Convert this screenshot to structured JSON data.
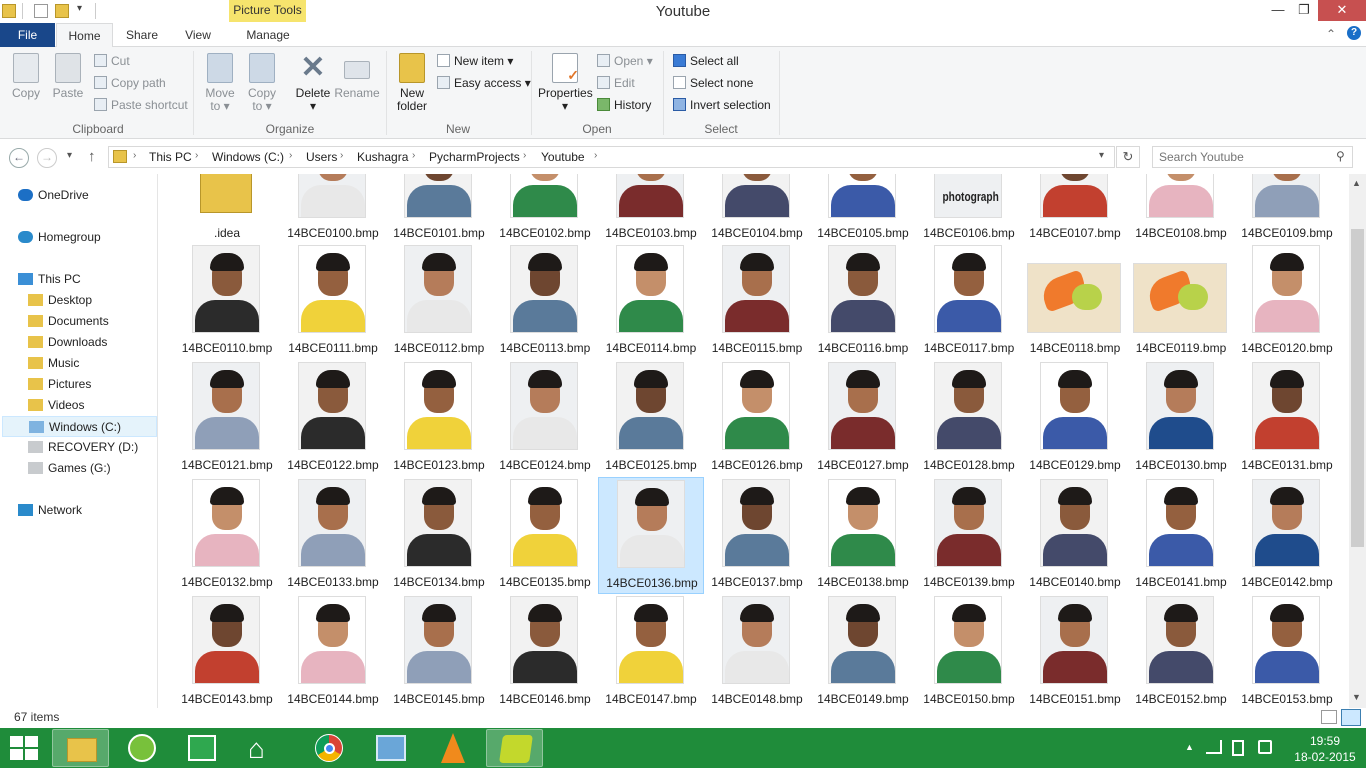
{
  "window": {
    "title": "Youtube",
    "picture_tools_label": "Picture Tools",
    "min_glyph": "—",
    "max_glyph": "❐",
    "close_glyph": "✕"
  },
  "tabs": {
    "file": "File",
    "home": "Home",
    "share": "Share",
    "view": "View",
    "manage": "Manage"
  },
  "ribbon": {
    "clipboard": {
      "label": "Clipboard",
      "copy": "Copy",
      "paste": "Paste",
      "cut": "Cut",
      "copy_path": "Copy path",
      "paste_shortcut": "Paste shortcut"
    },
    "organize": {
      "label": "Organize",
      "move_to": "Move",
      "move_to_2": "to",
      "copy_to": "Copy",
      "copy_to_2": "to",
      "delete": "Delete",
      "rename": "Rename"
    },
    "new": {
      "label": "New",
      "new_folder": "New",
      "new_folder_2": "folder",
      "new_item": "New item",
      "easy_access": "Easy access"
    },
    "open": {
      "label": "Open",
      "properties": "Properties",
      "open": "Open",
      "edit": "Edit",
      "history": "History"
    },
    "select": {
      "label": "Select",
      "select_all": "Select all",
      "select_none": "Select none",
      "invert": "Invert selection"
    }
  },
  "address": {
    "crumbs": [
      "This PC",
      "Windows (C:)",
      "Users",
      "Kushagra",
      "PycharmProjects",
      "Youtube"
    ],
    "search_placeholder": "Search Youtube"
  },
  "nav": {
    "onedrive": "OneDrive",
    "homegroup": "Homegroup",
    "this_pc": "This PC",
    "desktop": "Desktop",
    "documents": "Documents",
    "downloads": "Downloads",
    "music": "Music",
    "pictures": "Pictures",
    "videos": "Videos",
    "windows_c": "Windows (C:)",
    "recovery_d": "RECOVERY (D:)",
    "games_g": "Games (G:)",
    "network": "Network"
  },
  "files": {
    "partial_row": [
      ".idea",
      "14BCE0100.bmp",
      "14BCE0101.bmp",
      "14BCE0102.bmp",
      "14BCE0103.bmp",
      "14BCE0104.bmp",
      "14BCE0105.bmp",
      "14BCE0106.bmp",
      "14BCE0107.bmp",
      "14BCE0108.bmp",
      "14BCE0109.bmp"
    ],
    "row1": [
      "14BCE0110.bmp",
      "14BCE0111.bmp",
      "14BCE0112.bmp",
      "14BCE0113.bmp",
      "14BCE0114.bmp",
      "14BCE0115.bmp",
      "14BCE0116.bmp",
      "14BCE0117.bmp",
      "14BCE0118.bmp",
      "14BCE0119.bmp",
      "14BCE0120.bmp"
    ],
    "row2": [
      "14BCE0121.bmp",
      "14BCE0122.bmp",
      "14BCE0123.bmp",
      "14BCE0124.bmp",
      "14BCE0125.bmp",
      "14BCE0126.bmp",
      "14BCE0127.bmp",
      "14BCE0128.bmp",
      "14BCE0129.bmp",
      "14BCE0130.bmp",
      "14BCE0131.bmp"
    ],
    "row3": [
      "14BCE0132.bmp",
      "14BCE0133.bmp",
      "14BCE0134.bmp",
      "14BCE0135.bmp",
      "14BCE0136.bmp",
      "14BCE0137.bmp",
      "14BCE0138.bmp",
      "14BCE0139.bmp",
      "14BCE0140.bmp",
      "14BCE0141.bmp",
      "14BCE0142.bmp"
    ],
    "row4": [
      "14BCE0143.bmp",
      "14BCE0144.bmp",
      "14BCE0145.bmp",
      "14BCE0146.bmp",
      "14BCE0147.bmp",
      "14BCE0148.bmp",
      "14BCE0149.bmp",
      "14BCE0150.bmp",
      "14BCE0151.bmp",
      "14BCE0152.bmp",
      "14BCE0153.bmp"
    ],
    "selected": "14BCE0136.bmp",
    "photograph_text": "photograph"
  },
  "status": {
    "item_count": "67 items"
  },
  "taskbar": {
    "time": "19:59",
    "date": "18-02-2015"
  },
  "colors": {
    "file_tab": "#19478a",
    "picture_tools": "#f6e46d",
    "close_button": "#c75050",
    "selection": "#cce8ff",
    "taskbar": "#1f8c3a"
  }
}
